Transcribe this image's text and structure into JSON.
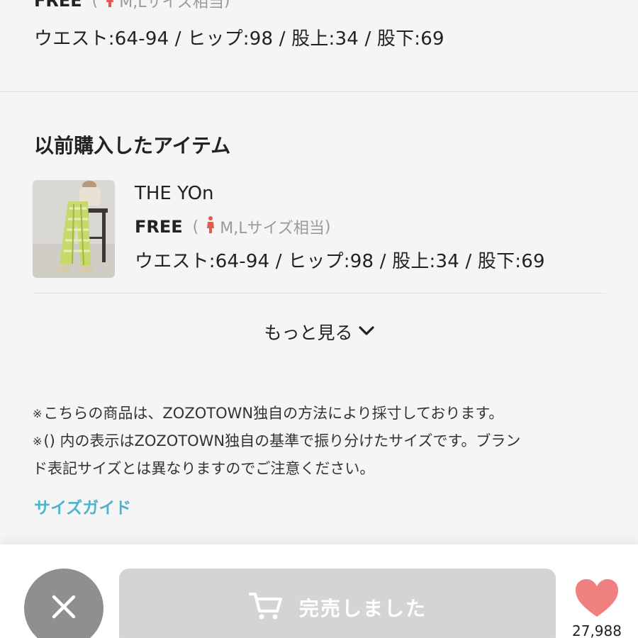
{
  "top_item": {
    "size": "FREE",
    "equivalent": "M,Lサイズ相当",
    "paren_open": "(",
    "paren_close": ")",
    "measurements": "ウエスト:64-94 / ヒップ:98 / 股上:34 / 股下:69"
  },
  "previous_purchases": {
    "title": "以前購入したアイテム",
    "items": [
      {
        "brand": "THE YOn",
        "size": "FREE",
        "equivalent": "M,Lサイズ相当",
        "measurements": "ウエスト:64-94 / ヒップ:98 / 股上:34 / 股下:69"
      }
    ],
    "more_label": "もっと見る"
  },
  "notes": {
    "mark": "※",
    "line1": "こちらの商品は、ZOZOTOWN独自の方法により採寸しております。",
    "line2": "() 内の表示はZOZOTOWN独自の基準で振り分けたサイズです。ブラン",
    "line3": "ド表記サイズとは異なりますのでご注意ください。"
  },
  "size_guide_label": "サイズガイド",
  "bottom_bar": {
    "soldout_label": "完売しました",
    "favorite_count": "27,988"
  },
  "colors": {
    "accent_link": "#4fb3cc",
    "favorite_heart": "#f08080",
    "person_icon": "#e05a4f",
    "soldout_bg": "#d4d4d4",
    "close_bg": "#8f8f8f"
  },
  "icons": {
    "person": "person-icon",
    "chevron": "chevron-down-icon",
    "close": "close-icon",
    "cart": "cart-icon",
    "heart": "heart-icon"
  }
}
